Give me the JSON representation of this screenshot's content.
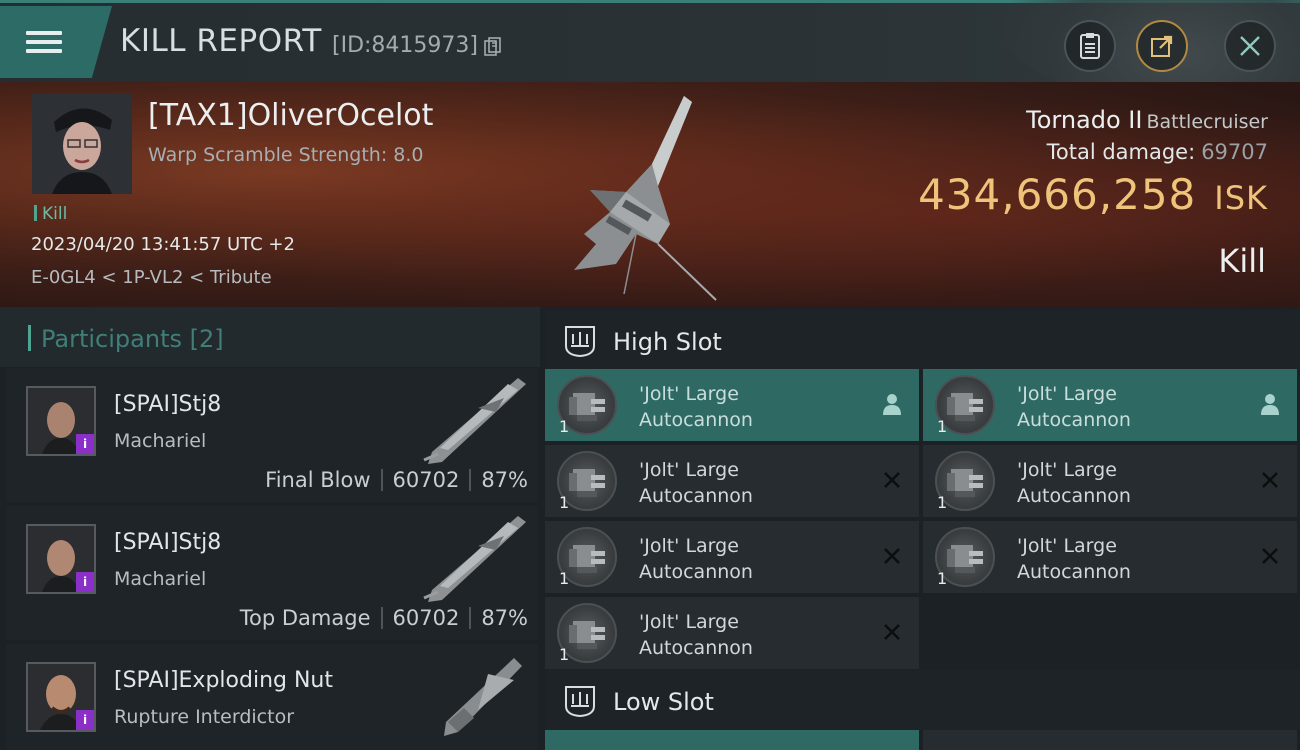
{
  "header": {
    "title": "KILL REPORT",
    "report_id": "[ID:8415973]"
  },
  "victim": {
    "pilot_name": "[TAX1]OliverOcelot",
    "warp_scramble": "Warp Scramble Strength: 8.0",
    "tag": "Kill",
    "datetime": "2023/04/20 13:41:57 UTC +2",
    "location": "E-0GL4 < 1P-VL2 < Tribute",
    "ship_name": "Tornado II",
    "ship_class": "Battlecruiser",
    "total_damage_label": "Total damage:",
    "total_damage": "69707",
    "isk_value": "434,666,258",
    "isk_unit": "ISK",
    "outcome": "Kill"
  },
  "participants": {
    "title": "Participants",
    "count": "[2]",
    "rows": [
      {
        "name": "[SPAI]Stj8",
        "ship": "Machariel",
        "role": "Final Blow",
        "damage": "60702",
        "percent": "87%"
      },
      {
        "name": "[SPAI]Stj8",
        "ship": "Machariel",
        "role": "Top Damage",
        "damage": "60702",
        "percent": "87%"
      },
      {
        "name": "[SPAI]Exploding Nut",
        "ship": "Rupture Interdictor",
        "role": "",
        "damage": "",
        "percent": ""
      }
    ]
  },
  "slots": {
    "high_label": "High Slot",
    "low_label": "Low Slot",
    "high_modules": [
      {
        "line1": "'Jolt' Large",
        "line2": "Autocannon",
        "qty": "1",
        "status": "fitted"
      },
      {
        "line1": "'Jolt' Large",
        "line2": "Autocannon",
        "qty": "1",
        "status": "fitted"
      },
      {
        "line1": "'Jolt' Large",
        "line2": "Autocannon",
        "qty": "1",
        "status": "destroyed"
      },
      {
        "line1": "'Jolt' Large",
        "line2": "Autocannon",
        "qty": "1",
        "status": "destroyed"
      },
      {
        "line1": "'Jolt' Large",
        "line2": "Autocannon",
        "qty": "1",
        "status": "destroyed"
      },
      {
        "line1": "'Jolt' Large",
        "line2": "Autocannon",
        "qty": "1",
        "status": "destroyed"
      },
      {
        "line1": "'Jolt' Large",
        "line2": "Autocannon",
        "qty": "1",
        "status": "destroyed"
      }
    ]
  },
  "colors": {
    "accent_teal": "#2f6964",
    "isk_gold": "#efc47a",
    "purple_badge": "#8a2fc7"
  }
}
